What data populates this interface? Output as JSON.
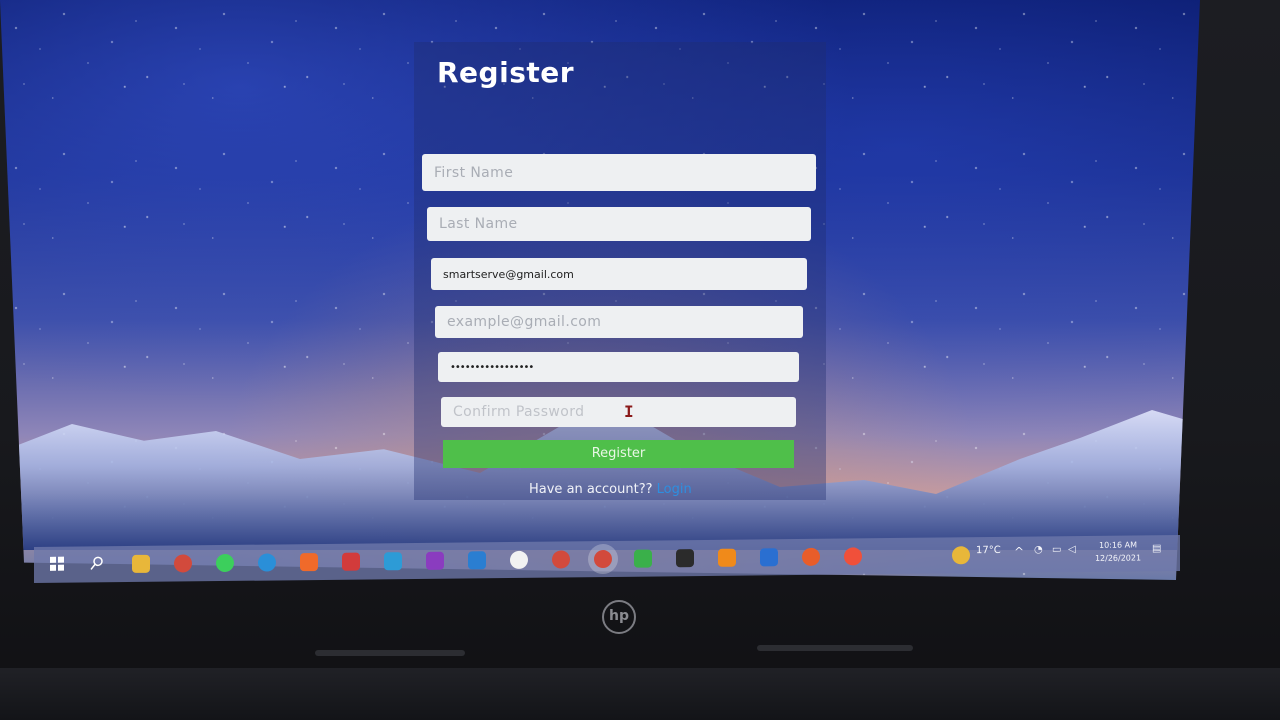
{
  "window": {
    "title": "Register"
  },
  "form": {
    "first_name_placeholder": "First Name",
    "last_name_placeholder": "Last Name",
    "email_value": "smartserve@gmail.com",
    "email2_placeholder": "example@gmail.com",
    "password_value": "•••••••••••••••••",
    "confirm_password_placeholder": "Confirm Password",
    "register_label": "Register",
    "have_account_text": "Have an account??",
    "login_label": "Login"
  },
  "taskbar": {
    "weather": "17°C",
    "time": "10:16 AM",
    "date": "12/26/2021",
    "icons": [
      "windows-start-icon",
      "search-icon",
      "file-explorer-icon",
      "chrome-icon",
      "whatsapp-icon",
      "edge-icon",
      "brave-icon",
      "devcpp-icon",
      "todo-icon",
      "onenote-icon",
      "vscode-icon",
      "app-icon",
      "chrome-alt-icon",
      "chrome-active-icon",
      "drive-icon",
      "terminal-icon",
      "vlc-icon",
      "sourcetree-icon",
      "postman-icon",
      "git-icon"
    ]
  },
  "device": {
    "brand": "hp"
  },
  "colors": {
    "register_button": "#4fbf4a",
    "login_link": "#2d8fe0",
    "panel_tint": "#202c6e"
  }
}
